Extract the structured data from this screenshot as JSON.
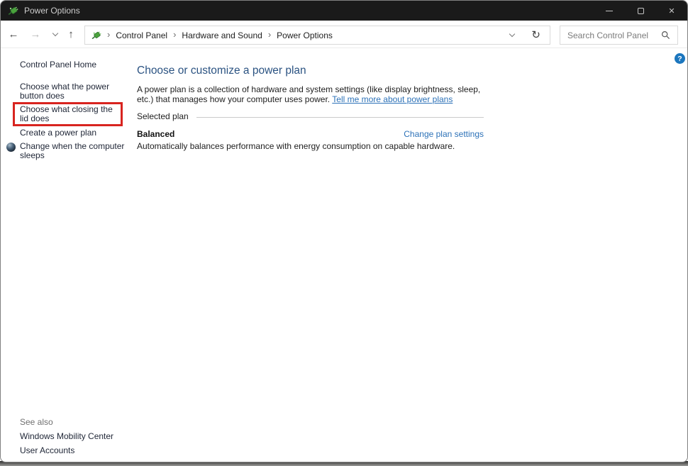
{
  "window": {
    "title": "Power Options"
  },
  "titlebar": {
    "minimize": "minimize",
    "maximize": "maximize",
    "close": "close"
  },
  "navbar": {
    "breadcrumb": [
      "Control Panel",
      "Hardware and Sound",
      "Power Options"
    ],
    "search_placeholder": "Search Control Panel"
  },
  "sidebar": {
    "home": "Control Panel Home",
    "tasks": [
      {
        "label": "Choose what the power button does",
        "highlighted": false
      },
      {
        "label": "Choose what closing the lid does",
        "highlighted": true
      },
      {
        "label": "Create a power plan",
        "highlighted": false
      },
      {
        "label": "Change when the computer sleeps",
        "highlighted": false,
        "icon": "sleep-icon"
      }
    ],
    "see_also": {
      "title": "See also",
      "links": [
        "Windows Mobility Center",
        "User Accounts"
      ]
    }
  },
  "main": {
    "heading": "Choose or customize a power plan",
    "description": "A power plan is a collection of hardware and system settings (like display brightness, sleep, etc.) that manages how your computer uses power. ",
    "description_link": "Tell me more about power plans",
    "selected_plan_label": "Selected plan",
    "plan": {
      "name": "Balanced",
      "description": "Automatically balances performance with energy consumption on capable hardware.",
      "action": "Change plan settings"
    },
    "help": "?"
  },
  "icons": {
    "app": "power-plug-green",
    "back": "←",
    "forward": "→",
    "up": "↑",
    "breadcrumb_chevron": "›",
    "refresh": "↻",
    "close": "✕",
    "search": "magnifier",
    "sleep": "moon-sphere"
  },
  "colors": {
    "titlebar_bg": "#1a1a1a",
    "heading_blue": "#2b5382",
    "link_blue": "#2d72b8",
    "highlight_red": "#d8241f",
    "help_blue": "#1b76be",
    "sidebar_text": "#212838"
  }
}
